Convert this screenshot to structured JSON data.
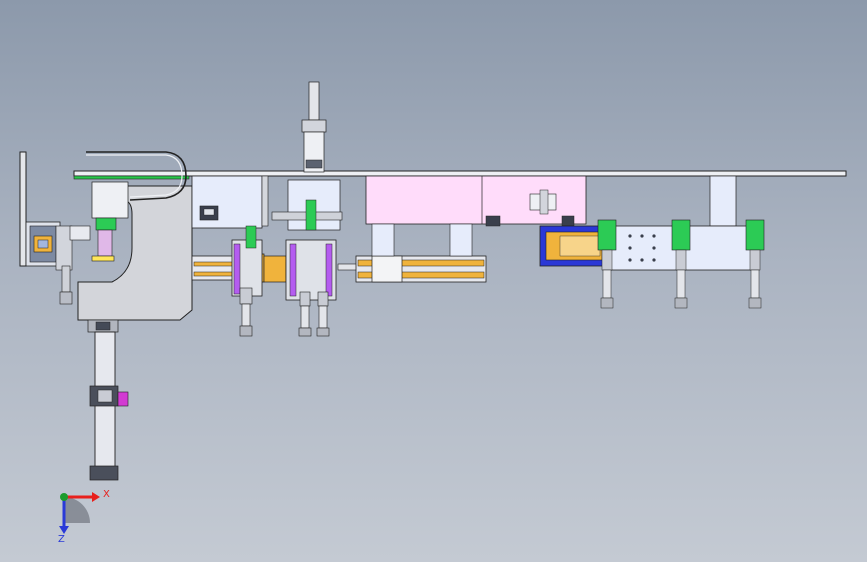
{
  "colors": {
    "background_top": "#8c99ab",
    "background_bottom": "#c4cad3",
    "outline": "#1b1b1b",
    "frame_gray": "#d9dbe0",
    "pale_blue": "#e6ecfb",
    "pink": "#ffdcfa",
    "orange": "#f0b33c",
    "green": "#1fc64a",
    "blue": "#2a38d6",
    "purple": "#b45cf0",
    "magenta": "#d23ad2",
    "yellow": "#ffe65a",
    "axis_x": "#e8201c",
    "axis_y": "#1c9c2c",
    "axis_z": "#2a3ad8"
  },
  "triad": {
    "x_label": "X",
    "z_label": "Z"
  },
  "icons": [
    "c-frame-press-icon",
    "linear-slide-icon",
    "pneumatic-cylinder-icon",
    "gripper-icon",
    "axis-triad-icon"
  ]
}
